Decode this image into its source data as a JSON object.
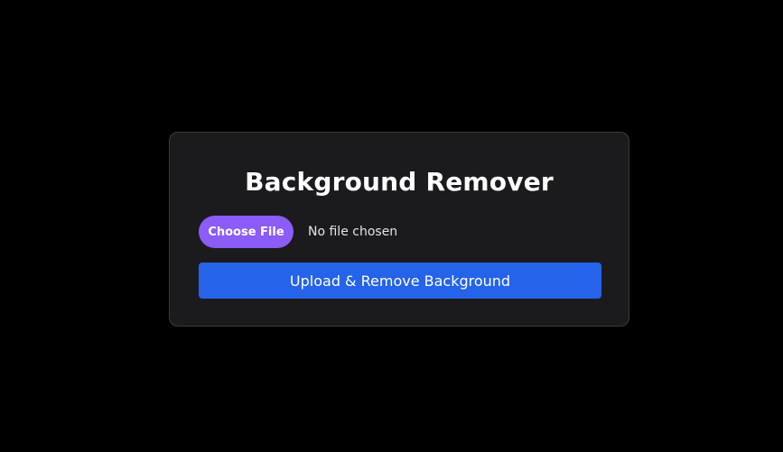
{
  "card": {
    "title": "Background Remover"
  },
  "file_input": {
    "button_label": "Choose File",
    "status_text": "No file chosen"
  },
  "actions": {
    "upload_label": "Upload & Remove Background"
  },
  "colors": {
    "background": "#000000",
    "card_background": "#1b1b1e",
    "choose_button": "#8b5cf6",
    "upload_button": "#2563eb",
    "text": "#ffffff"
  }
}
